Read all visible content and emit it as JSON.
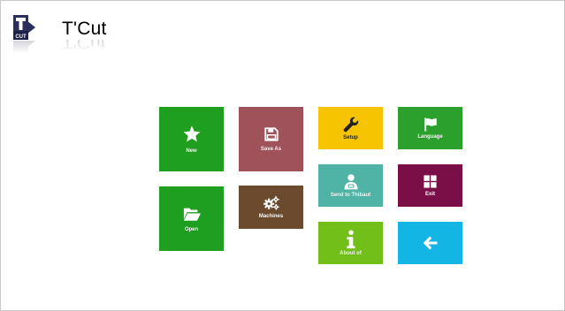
{
  "app": {
    "title": "T'Cut",
    "logo_text": "CUT"
  },
  "tiles": [
    {
      "id": "new",
      "label": "New",
      "color": "#1f9f1f",
      "icon": "star-icon"
    },
    {
      "id": "save-as",
      "label": "Save As",
      "color": "#a0525a",
      "icon": "floppy-disk-icon"
    },
    {
      "id": "setup",
      "label": "Setup",
      "color": "#f6c400",
      "icon": "wrench-icon"
    },
    {
      "id": "language",
      "label": "Language",
      "color": "#2ca02c",
      "icon": "flag-icon"
    },
    {
      "id": "open",
      "label": "Open",
      "color": "#1f9f1f",
      "icon": "folder-open-icon"
    },
    {
      "id": "machines",
      "label": "Machines",
      "color": "#6b4a2e",
      "icon": "gears-icon"
    },
    {
      "id": "send-to-thibaut",
      "label": "Send to Thibaut",
      "color": "#4fb3a5",
      "icon": "support-person-icon"
    },
    {
      "id": "exit",
      "label": "Exit",
      "color": "#7a0e47",
      "icon": "windows-logo-icon"
    },
    {
      "id": "about",
      "label": "About of",
      "color": "#72bf1a",
      "icon": "info-icon"
    },
    {
      "id": "back",
      "label": "",
      "color": "#12b5e3",
      "icon": "back-arrow-icon"
    }
  ]
}
